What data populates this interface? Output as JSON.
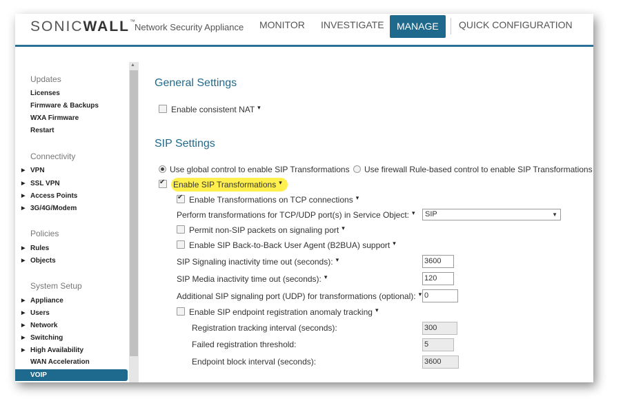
{
  "header": {
    "logo_prefix": "SONIC",
    "logo_bold": "WALL",
    "tagline": "Network Security Appliance",
    "nav": [
      "MONITOR",
      "INVESTIGATE",
      "MANAGE",
      "QUICK CONFIGURATION"
    ],
    "active_nav": "MANAGE",
    "accent_color": "#1f6a8c"
  },
  "sidebar": {
    "updates_group": "Updates",
    "updates_items": [
      "Licenses",
      "Firmware & Backups",
      "WXA Firmware",
      "Restart"
    ],
    "connectivity_group": "Connectivity",
    "connectivity_items": [
      "VPN",
      "SSL VPN",
      "Access Points",
      "3G/4G/Modem"
    ],
    "policies_group": "Policies",
    "policies_items": [
      "Rules",
      "Objects"
    ],
    "system_group": "System Setup",
    "system_items": [
      "Appliance",
      "Users",
      "Network",
      "Switching",
      "High Availability",
      "WAN Acceleration",
      "VOIP"
    ],
    "active_item": "VOIP"
  },
  "general": {
    "title": "General Settings",
    "consistent_nat": "Enable consistent NAT"
  },
  "sip": {
    "title": "SIP Settings",
    "radio_global": "Use global control to enable SIP Transformations",
    "radio_rule": "Use firewall Rule-based control to enable SIP Transformations",
    "enable_transformations": "Enable SIP Transformations",
    "enable_tcp": "Enable Transformations on TCP connections",
    "perform_label": "Perform transformations for TCP/UDP port(s) in Service Object:",
    "service_object": "SIP",
    "permit_non_sip": "Permit non-SIP packets on signaling port",
    "b2bua": "Enable SIP Back-to-Back User Agent (B2BUA) support",
    "signaling_timeout_label": "SIP Signaling inactivity time out (seconds):",
    "signaling_timeout": "3600",
    "media_timeout_label": "SIP Media inactivity time out (seconds):",
    "media_timeout": "120",
    "additional_port_label": "Additional SIP signaling port (UDP) for transformations (optional):",
    "additional_port": "0",
    "anomaly_tracking": "Enable SIP endpoint registration anomaly tracking",
    "reg_interval_label": "Registration tracking interval (seconds):",
    "reg_interval": "300",
    "failed_threshold_label": "Failed registration threshold:",
    "failed_threshold": "5",
    "block_interval_label": "Endpoint block interval (seconds):",
    "block_interval": "3600"
  },
  "highlight_color": "#fff04d"
}
